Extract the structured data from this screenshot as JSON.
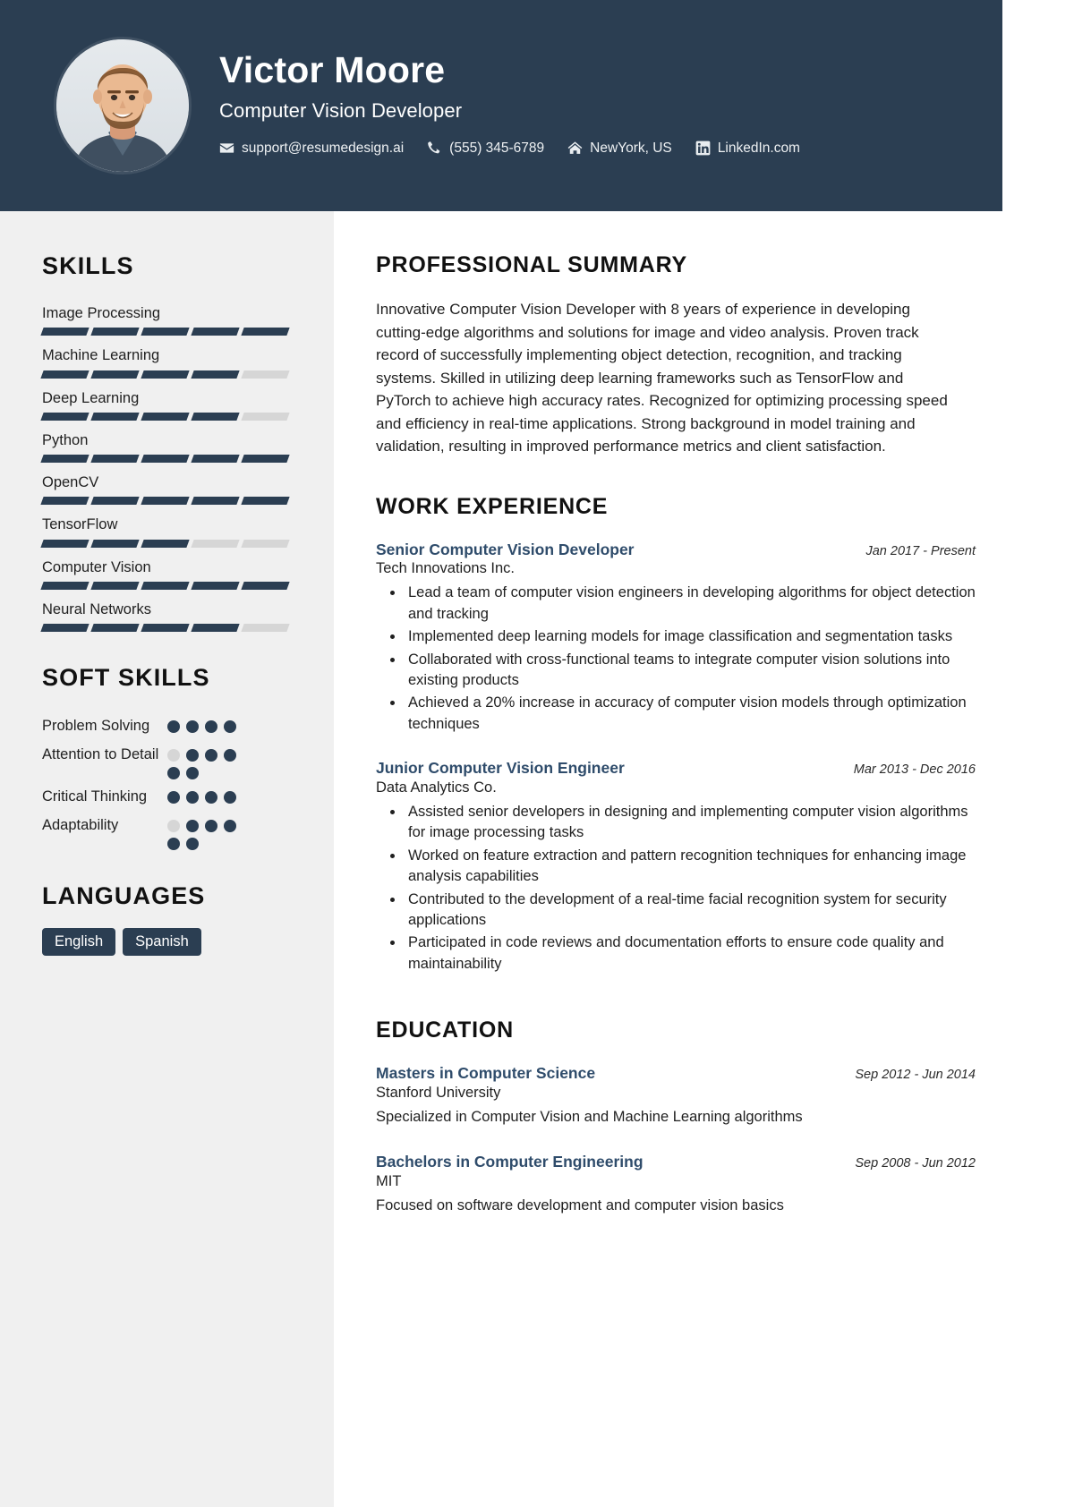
{
  "theme": {
    "navy": "#2b3e52",
    "sidebar_bg": "#f0f0f0",
    "accent_heading": "#2f4c6b",
    "bar_off": "#d6d6d6"
  },
  "header": {
    "name": "Victor Moore",
    "job_title": "Computer Vision Developer",
    "contacts": [
      {
        "icon": "email-icon",
        "text": "support@resumedesign.ai"
      },
      {
        "icon": "phone-icon",
        "text": "(555) 345-6789"
      },
      {
        "icon": "home-icon",
        "text": "NewYork, US"
      },
      {
        "icon": "linkedin-icon",
        "text": "LinkedIn.com"
      }
    ]
  },
  "sidebar": {
    "skills_title": "SKILLS",
    "skills": [
      {
        "name": "Image Processing",
        "filled": 5,
        "total": 5
      },
      {
        "name": "Machine Learning",
        "filled": 4,
        "total": 5
      },
      {
        "name": "Deep Learning",
        "filled": 4,
        "total": 5
      },
      {
        "name": "Python",
        "filled": 5,
        "total": 5
      },
      {
        "name": "OpenCV",
        "filled": 5,
        "total": 5
      },
      {
        "name": "TensorFlow",
        "filled": 3,
        "total": 5
      },
      {
        "name": "Computer Vision",
        "filled": 5,
        "total": 5
      },
      {
        "name": "Neural Networks",
        "filled": 4,
        "total": 5
      }
    ],
    "soft_skills_title": "SOFT SKILLS",
    "soft_skills": [
      {
        "name": "Problem Solving",
        "filled": 4,
        "total": 4
      },
      {
        "name": "Attention to Detail",
        "filled": 4,
        "total": 5
      },
      {
        "name": "Critical Thinking",
        "filled": 4,
        "total": 4
      },
      {
        "name": "Adaptability",
        "filled": 4,
        "total": 5
      }
    ],
    "languages_title": "LANGUAGES",
    "languages": [
      "English",
      "Spanish"
    ]
  },
  "main": {
    "summary_title": "PROFESSIONAL SUMMARY",
    "summary_text": "Innovative Computer Vision Developer with 8 years of experience in developing cutting-edge algorithms and solutions for image and video analysis. Proven track record of successfully implementing object detection, recognition, and tracking systems. Skilled in utilizing deep learning frameworks such as TensorFlow and PyTorch to achieve high accuracy rates. Recognized for optimizing processing speed and efficiency in real-time applications. Strong background in model training and validation, resulting in improved performance metrics and client satisfaction.",
    "work_title": "WORK EXPERIENCE",
    "work": [
      {
        "title": "Senior Computer Vision Developer",
        "company": "Tech Innovations Inc.",
        "date": "Jan 2017 - Present",
        "bullets": [
          "Lead a team of computer vision engineers in developing algorithms for object detection and tracking",
          "Implemented deep learning models for image classification and segmentation tasks",
          "Collaborated with cross-functional teams to integrate computer vision solutions into existing products",
          "Achieved a 20% increase in accuracy of computer vision models through optimization techniques"
        ]
      },
      {
        "title": "Junior Computer Vision Engineer",
        "company": "Data Analytics Co.",
        "date": "Mar 2013 - Dec 2016",
        "bullets": [
          "Assisted senior developers in designing and implementing computer vision algorithms for image processing tasks",
          "Worked on feature extraction and pattern recognition techniques for enhancing image analysis capabilities",
          "Contributed to the development of a real-time facial recognition system for security applications",
          "Participated in code reviews and documentation efforts to ensure code quality and maintainability"
        ]
      }
    ],
    "education_title": "EDUCATION",
    "education": [
      {
        "degree": "Masters in Computer Science",
        "school": "Stanford University",
        "date": "Sep 2012 - Jun 2014",
        "description": "Specialized in Computer Vision and Machine Learning algorithms"
      },
      {
        "degree": "Bachelors in Computer Engineering",
        "school": "MIT",
        "date": "Sep 2008 - Jun 2012",
        "description": "Focused on software development and computer vision basics"
      }
    ]
  }
}
